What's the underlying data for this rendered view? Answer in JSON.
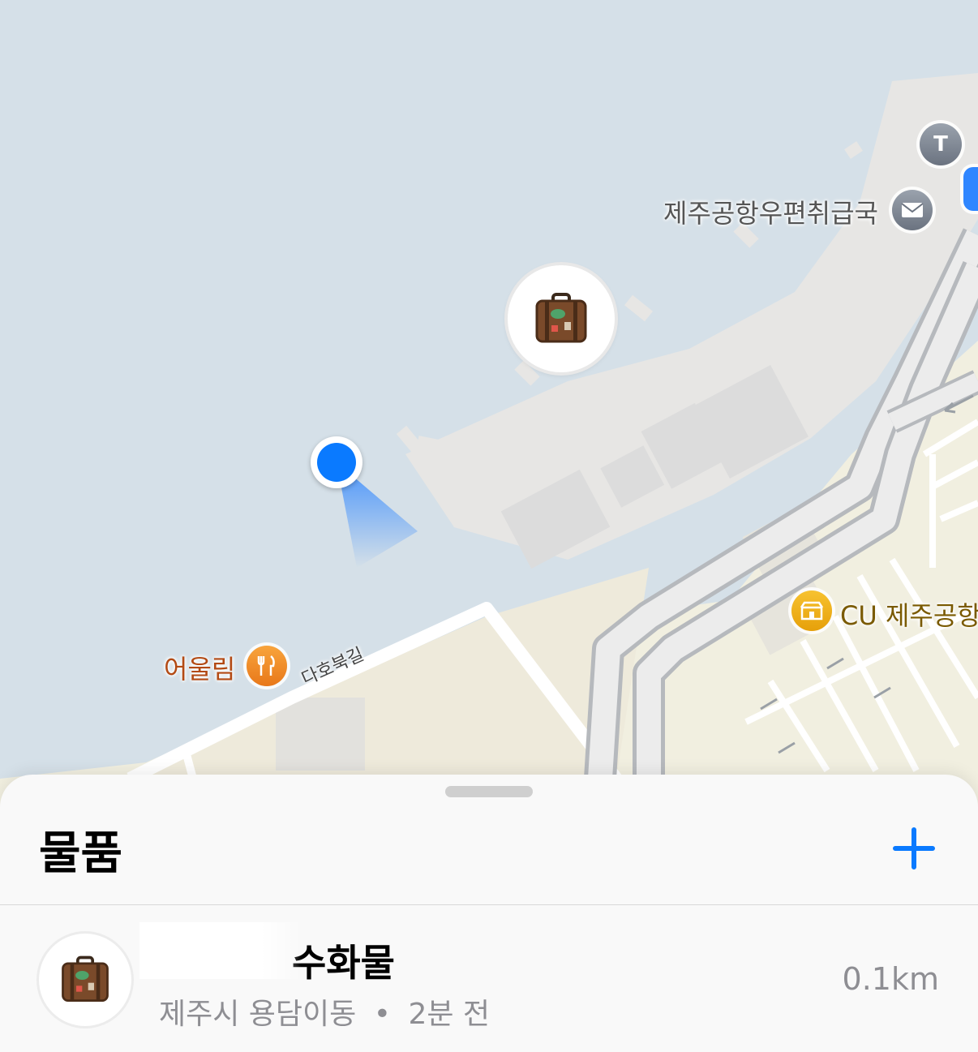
{
  "map": {
    "poi_post_office": "제주공항우편취급국",
    "poi_restaurant": "어울림",
    "poi_store": "CU 제주공항",
    "road_label": "다호북길",
    "icons": {
      "taxi": "taxi-icon",
      "mail": "envelope-icon",
      "restaurant": "fork-knife-icon",
      "store": "convenience-store-icon",
      "item_pin": "suitcase-icon",
      "user": "user-location-dot"
    }
  },
  "sheet": {
    "title": "물품",
    "add_icon": "plus-icon",
    "items": [
      {
        "name": "수화물",
        "location": "제주시 용담이동",
        "separator": "•",
        "time": "2분 전",
        "distance": "0.1km"
      }
    ]
  },
  "colors": {
    "accent": "#0a7aff",
    "water": "#d5e0e8",
    "land": "#f2efe2",
    "apron": "#e8e8e8",
    "restaurant": "#f29224",
    "store": "#f2b51a"
  }
}
